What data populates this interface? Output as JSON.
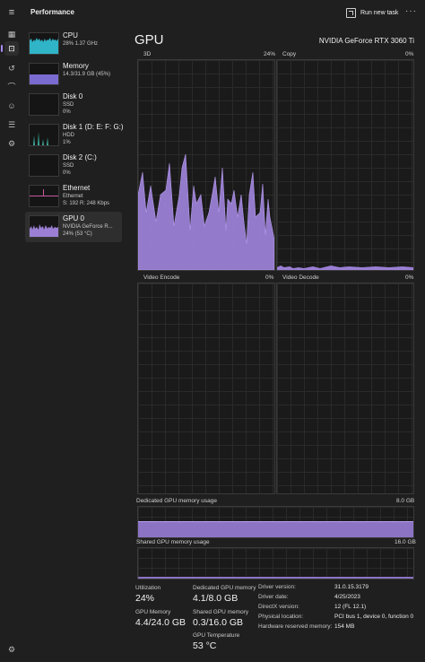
{
  "app": {
    "title": "Performance",
    "run_new_task": "Run new task"
  },
  "sidebar": [
    {
      "name": "CPU",
      "line1": "28%  1.37 GHz",
      "line2": ""
    },
    {
      "name": "Memory",
      "line1": "14.3/31.9 GB (45%)",
      "line2": ""
    },
    {
      "name": "Disk 0",
      "line1": "SSD",
      "line2": "0%"
    },
    {
      "name": "Disk 1 (D: E: F: G:)",
      "line1": "HDD",
      "line2": "1%"
    },
    {
      "name": "Disk 2 (C:)",
      "line1": "SSD",
      "line2": "0%"
    },
    {
      "name": "Ethernet",
      "line1": "Ethernet",
      "line2": "S: 192  R: 248 Kbps"
    },
    {
      "name": "GPU 0",
      "line1": "NVIDIA GeForce R...",
      "line2": "24%  (53 °C)"
    }
  ],
  "gpu": {
    "title": "GPU",
    "model": "NVIDIA GeForce RTX 3060 Ti",
    "graphs": {
      "g3d": {
        "label": "3D",
        "percent": "24%"
      },
      "copy": {
        "label": "Copy",
        "percent": "0%"
      },
      "venc": {
        "label": "Video Encode",
        "percent": "0%"
      },
      "vdec": {
        "label": "Video Decode",
        "percent": "0%"
      }
    },
    "dedicated": {
      "label": "Dedicated GPU memory usage",
      "max": "8.0 GB",
      "fill": 0.51
    },
    "shared": {
      "label": "Shared GPU memory usage",
      "max": "16.0 GB",
      "fill": 0.02
    },
    "stats": {
      "utilization_label": "Utilization",
      "utilization": "24%",
      "gpu_memory_label": "GPU Memory",
      "gpu_memory": "4.4/24.0 GB",
      "dedicated_label": "Dedicated GPU memory",
      "dedicated": "4.1/8.0 GB",
      "shared_label": "Shared GPU memory",
      "shared": "0.3/16.0 GB",
      "temp_label": "GPU Temperature",
      "temp": "53 °C"
    },
    "details": [
      {
        "k": "Driver version:",
        "v": "31.0.15.3179"
      },
      {
        "k": "Driver date:",
        "v": "4/25/2023"
      },
      {
        "k": "DirectX version:",
        "v": "12 (FL 12.1)"
      },
      {
        "k": "Physical location:",
        "v": "PCI bus 1, device 0, function 0"
      },
      {
        "k": "Hardware reserved memory:",
        "v": "154 MB"
      }
    ]
  },
  "colors": {
    "gpu": "#9b7fd4",
    "cpu": "#2fb4c8",
    "memory": "#7a6bd0",
    "disk": "#3fb0a0",
    "ethernet": "#c65aa0"
  },
  "icons": [
    "hamburger-icon",
    "processes-icon",
    "performance-icon",
    "app-history-icon",
    "startup-icon",
    "users-icon",
    "details-icon",
    "services-icon",
    "settings-icon"
  ]
}
